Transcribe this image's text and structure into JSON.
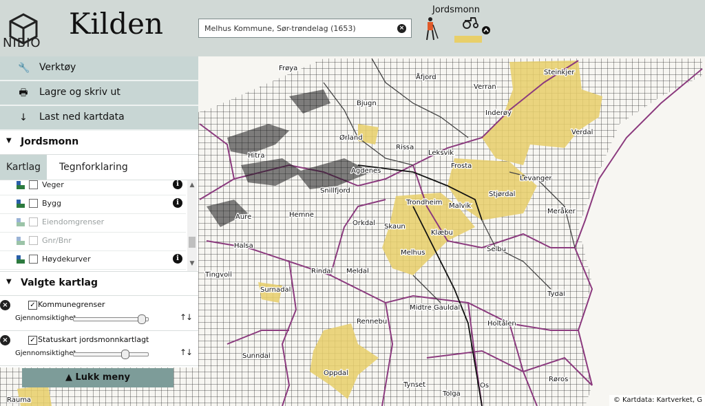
{
  "app": {
    "org": "NIBIO",
    "title": "Kilden"
  },
  "search": {
    "value": "Melhus Kommune, Sør-trøndelag (1653)",
    "clear_glyph": "×"
  },
  "theme": {
    "label": "Jordsmonn",
    "collapse_glyph": "^"
  },
  "menu": [
    {
      "label": "Verktøy",
      "icon": "wrench-icon"
    },
    {
      "label": "Lagre og skriv ut",
      "icon": "printer-icon"
    },
    {
      "label": "Last ned kartdata",
      "icon": "download-icon"
    }
  ],
  "section": {
    "label": "Jordsmonn"
  },
  "tabs": {
    "active": "Kartlag",
    "other": "Tegnforklaring"
  },
  "layers": [
    {
      "name": "Veger",
      "enabled": true,
      "has_info": true
    },
    {
      "name": "Bygg",
      "enabled": true,
      "has_info": true
    },
    {
      "name": "Eiendomgrenser",
      "enabled": false,
      "has_info": false
    },
    {
      "name": "Gnr/Bnr",
      "enabled": false,
      "has_info": false
    },
    {
      "name": "Høydekurver",
      "enabled": true,
      "has_info": true
    }
  ],
  "selected": {
    "header": "Valgte kartlag",
    "opacity_label": "Gjennomsiktighet",
    "items": [
      {
        "name": "Kommunegrenser",
        "checked": true,
        "opacity": 0.95,
        "order_glyph": "↑↓"
      },
      {
        "name": "Statuskart jordsmonnkartlagt",
        "checked": true,
        "opacity": 0.7,
        "order_glyph": "↑↓"
      }
    ]
  },
  "close_menu": {
    "label": "▲ Lukk meny"
  },
  "attribution": "© Kartdata: Kartverket, G",
  "places": [
    {
      "name": "Frøya"
    },
    {
      "name": "Åfjord"
    },
    {
      "name": "Steinkjer"
    },
    {
      "name": "Verran"
    },
    {
      "name": "Bjugn"
    },
    {
      "name": "Inderøy"
    },
    {
      "name": "Verdal"
    },
    {
      "name": "Ørland"
    },
    {
      "name": "Rissa"
    },
    {
      "name": "Leksvik"
    },
    {
      "name": "Hitra"
    },
    {
      "name": "Agdenes"
    },
    {
      "name": "Frosta"
    },
    {
      "name": "Snillfjord"
    },
    {
      "name": "Levanger"
    },
    {
      "name": "Stjørdal"
    },
    {
      "name": "Trondheim"
    },
    {
      "name": "Malvik"
    },
    {
      "name": "Hemne"
    },
    {
      "name": "Meråker"
    },
    {
      "name": "Aure"
    },
    {
      "name": "Orkdal"
    },
    {
      "name": "Skaun"
    },
    {
      "name": "Klæbu"
    },
    {
      "name": "Halsa"
    },
    {
      "name": "Melhus"
    },
    {
      "name": "Selbu"
    },
    {
      "name": "Tingvoll"
    },
    {
      "name": "Rindal"
    },
    {
      "name": "Meldal"
    },
    {
      "name": "Surnadal"
    },
    {
      "name": "Tydal"
    },
    {
      "name": "Midtre Gauldal"
    },
    {
      "name": "Rennebu"
    },
    {
      "name": "Holtålen"
    },
    {
      "name": "Sunndal"
    },
    {
      "name": "Oppdal"
    },
    {
      "name": "Røros"
    },
    {
      "name": "Tynset"
    },
    {
      "name": "Os"
    },
    {
      "name": "Tolga"
    },
    {
      "name": "Rauma"
    }
  ],
  "colors": {
    "header_bg": "#cdd6d4",
    "menu_bg": "#c8d6d4",
    "accent": "#7d9c99",
    "boundary": "#8b3a7e",
    "survey_fill": "#e8cf6a"
  }
}
